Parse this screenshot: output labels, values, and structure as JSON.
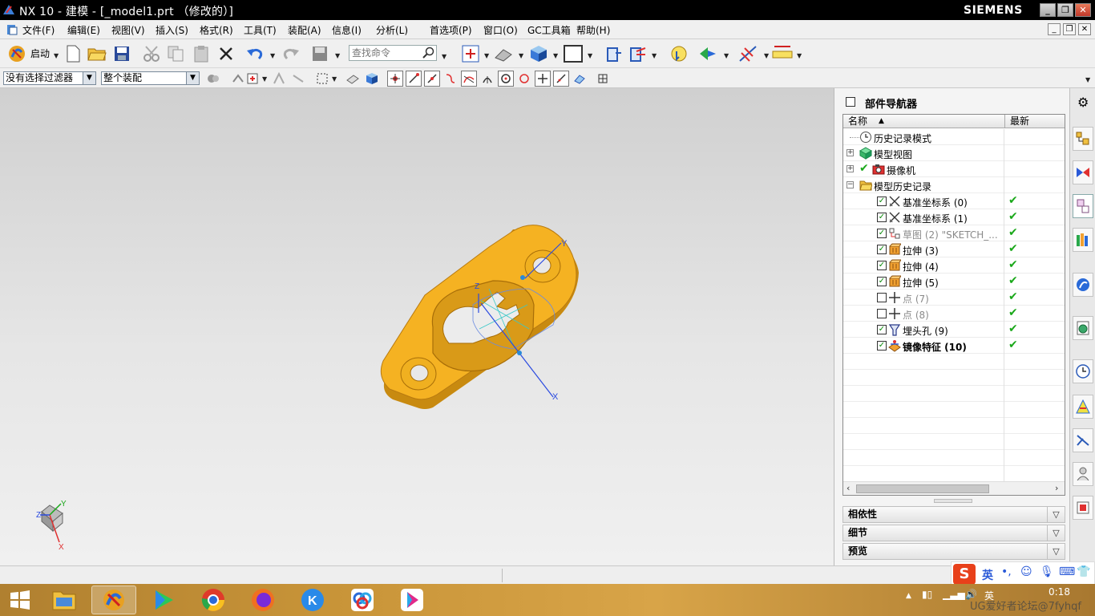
{
  "window": {
    "title": "NX 10 - 建模 - [_model1.prt （修改的）]",
    "brand": "SIEMENS",
    "minimize_label": "_",
    "restore_label": "❐",
    "close_label": "✕"
  },
  "menu": {
    "items": [
      "文件(F)",
      "编辑(E)",
      "视图(V)",
      "插入(S)",
      "格式(R)",
      "工具(T)",
      "装配(A)",
      "信息(I)",
      "分析(L)",
      "首选项(P)",
      "窗口(O)",
      "GC工具箱",
      "帮助(H)"
    ]
  },
  "toolbar": {
    "start_label": "启动",
    "search_placeholder": "查找命令"
  },
  "selection_bar": {
    "filter_value": "没有选择过滤器",
    "scope_value": "整个装配"
  },
  "viewport": {
    "csys_labels": {
      "x": "X",
      "y": "Y",
      "z": "Z"
    },
    "model_color": "#f5b222"
  },
  "navigator": {
    "title": "部件导航器",
    "col_name": "名称",
    "col_latest": "最新",
    "rows": [
      {
        "label": "历史记录模式",
        "style": "normal"
      },
      {
        "label": "模型视图",
        "style": "normal"
      },
      {
        "label": "摄像机",
        "style": "normal"
      },
      {
        "label": "模型历史记录",
        "style": "normal"
      },
      {
        "label": "基准坐标系 (0)",
        "style": "normal"
      },
      {
        "label": "基准坐标系 (1)",
        "style": "normal"
      },
      {
        "label": "草图 (2) \"SKETCH_...",
        "style": "dim"
      },
      {
        "label": "拉伸 (3)",
        "style": "normal"
      },
      {
        "label": "拉伸 (4)",
        "style": "normal"
      },
      {
        "label": "拉伸 (5)",
        "style": "normal"
      },
      {
        "label": "点 (7)",
        "style": "dim"
      },
      {
        "label": "点 (8)",
        "style": "dim"
      },
      {
        "label": "埋头孔 (9)",
        "style": "normal"
      },
      {
        "label": "镜像特征 (10)",
        "style": "bold"
      }
    ],
    "sections": [
      "相依性",
      "细节",
      "预览"
    ]
  },
  "ime": {
    "lang": "英"
  },
  "taskbar": {
    "time": "0:18",
    "lang": "英"
  },
  "watermark": "UG爱好者论坛@7fyhqf",
  "colors": {
    "accent_check": "#1aa81a",
    "model": "#f5b222"
  }
}
